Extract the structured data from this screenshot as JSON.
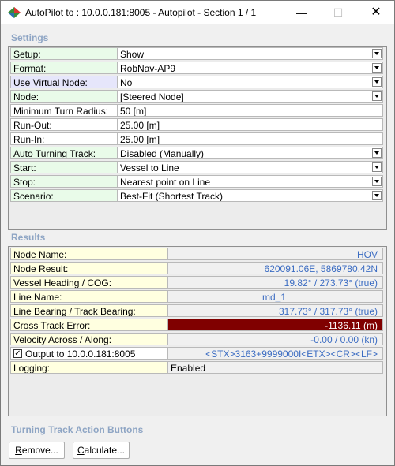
{
  "window": {
    "title": "AutoPilot to : 10.0.0.181:8005 - Autopilot - Section 1 / 1",
    "icon": "nav-diamond-icon",
    "controls": {
      "minimize": "—",
      "maximize": "☐",
      "close": "✕"
    }
  },
  "settings": {
    "label": "Settings",
    "rows": [
      {
        "label": "Setup:",
        "value": "Show",
        "dropdown": true,
        "style": "green"
      },
      {
        "label": "Format:",
        "value": "RobNav-AP9",
        "dropdown": true,
        "style": "green"
      },
      {
        "label": "Use Virtual Node:",
        "value": "No",
        "dropdown": true,
        "style": "blue"
      },
      {
        "label": "Node:",
        "value": "[Steered Node]",
        "dropdown": true,
        "style": "green"
      },
      {
        "label": "Minimum Turn Radius:",
        "value": "50 [m]",
        "dropdown": false,
        "style": "white"
      },
      {
        "label": "Run-Out:",
        "value": "25.00 [m]",
        "dropdown": false,
        "style": "white"
      },
      {
        "label": "Run-In:",
        "value": "25.00 [m]",
        "dropdown": false,
        "style": "white"
      },
      {
        "label": "Auto Turning Track:",
        "value": "Disabled (Manually)",
        "dropdown": true,
        "style": "green"
      },
      {
        "label": "Start:",
        "value": "Vessel to Line",
        "dropdown": true,
        "style": "green"
      },
      {
        "label": "Stop:",
        "value": "Nearest point on Line",
        "dropdown": true,
        "style": "green"
      },
      {
        "label": "Scenario:",
        "value": "Best-Fit (Shortest Track)",
        "dropdown": true,
        "style": "green"
      }
    ]
  },
  "results": {
    "label": "Results",
    "rows": [
      {
        "label": "Node Name:",
        "value": "HOV",
        "kind": "right"
      },
      {
        "label": "Node Result:",
        "value": "620091.06E, 5869780.42N",
        "kind": "right"
      },
      {
        "label": "Vessel Heading / COG:",
        "value": "19.82° / 273.73° (true)",
        "kind": "right"
      },
      {
        "label": "Line Name:",
        "value": "md_1",
        "kind": "center"
      },
      {
        "label": "Line Bearing / Track Bearing:",
        "value": "317.73° / 317.73° (true)",
        "kind": "right"
      },
      {
        "label": "Cross Track Error:",
        "value": "-1136.11 (m)",
        "kind": "alert"
      },
      {
        "label": "Velocity Across / Along:",
        "value": "-0.00 / 0.00 (kn)",
        "kind": "right"
      },
      {
        "label": "Output to 10.0.0.181:8005",
        "value": "<STX>3163+9999000I<ETX><CR><LF>",
        "kind": "right",
        "checkbox": true,
        "checked": true
      },
      {
        "label": "Logging:",
        "value": "Enabled",
        "kind": "plain"
      }
    ]
  },
  "turning": {
    "label": "Turning Track Action Buttons",
    "remove": {
      "mnemonic": "R",
      "rest": "emove..."
    },
    "calculate": {
      "mnemonic": "C",
      "rest": "alculate..."
    }
  },
  "colors": {
    "section_label": "#8ea5c4",
    "result_value": "#3b6cc2",
    "alert_bg": "#800000",
    "label_green": "#e9fbe9",
    "label_blue": "#e6e6fb",
    "label_yellow": "#ffffe0"
  }
}
